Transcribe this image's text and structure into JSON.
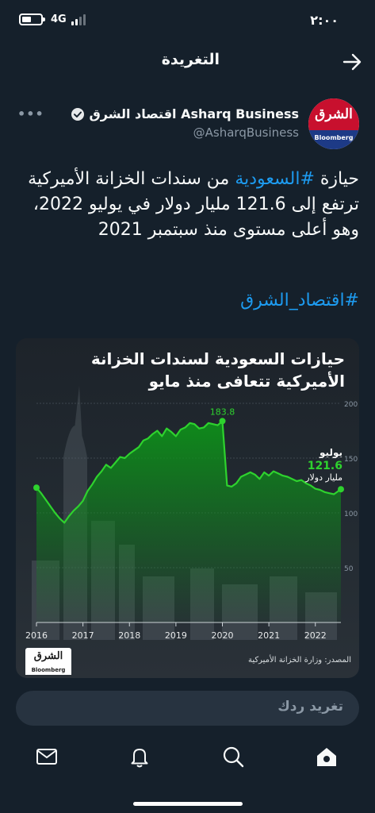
{
  "status_bar": {
    "time": "٢:٠٠",
    "network": "4G"
  },
  "header": {
    "title": "التغريدة"
  },
  "author": {
    "name": "اقتصاد الشرق Asharq Business",
    "handle": "@AsharqBusiness",
    "avatar_logo_top": "الشرق",
    "avatar_logo_bottom": "Bloomberg"
  },
  "tweet": {
    "text_before": "حيازة ",
    "hashtag_1": "#السعودية",
    "text_after": " من سندات الخزانة الأميركية ترتفع إلى 121.6 مليار دولار في يوليو 2022، وهو أعلى مستوى منذ سبتمبر 2021",
    "hashtag_2": "#اقتصاد_الشرق"
  },
  "media": {
    "title": "حيازات السعودية لسندات الخزانة الأميركية تتعافى منذ مايو",
    "source": "المصدر: وزارة الخزانة الأميركية",
    "logo_top": "الشرق",
    "logo_bottom": "Bloomberg"
  },
  "chart_data": {
    "type": "area",
    "title": "حيازات السعودية لسندات الخزانة الأميركية تتعافى منذ مايو",
    "x_ticks": [
      "2016",
      "2017",
      "2018",
      "2019",
      "2020",
      "2021",
      "2022"
    ],
    "y_ticks": [
      "200",
      "150",
      "100",
      "50"
    ],
    "ylabel": "",
    "ylim": [
      0,
      200
    ],
    "xlim": [
      2016,
      2022.55
    ],
    "grid": true,
    "x": [
      2016.0,
      2016.1,
      2016.2,
      2016.3,
      2016.4,
      2016.5,
      2016.6,
      2016.7,
      2016.8,
      2016.9,
      2017.0,
      2017.1,
      2017.2,
      2017.3,
      2017.4,
      2017.5,
      2017.6,
      2017.7,
      2017.8,
      2017.9,
      2018.0,
      2018.1,
      2018.2,
      2018.3,
      2018.4,
      2018.5,
      2018.6,
      2018.7,
      2018.8,
      2018.9,
      2019.0,
      2019.1,
      2019.2,
      2019.3,
      2019.4,
      2019.5,
      2019.6,
      2019.7,
      2019.8,
      2019.9,
      2020.0,
      2020.1,
      2020.2,
      2020.3,
      2020.4,
      2020.5,
      2020.6,
      2020.7,
      2020.8,
      2020.9,
      2021.0,
      2021.1,
      2021.2,
      2021.3,
      2021.4,
      2021.5,
      2021.6,
      2021.7,
      2021.8,
      2021.9,
      2022.0,
      2022.1,
      2022.2,
      2022.3,
      2022.4,
      2022.55
    ],
    "values": [
      123,
      118,
      112,
      106,
      100,
      95,
      91,
      97,
      102,
      106,
      111,
      120,
      126,
      133,
      138,
      144,
      141,
      146,
      151,
      150,
      154,
      157,
      160,
      166,
      168,
      172,
      175,
      170,
      177,
      174,
      170,
      176,
      178,
      182,
      181,
      177,
      178,
      182,
      181,
      180,
      183.8,
      125,
      124,
      127,
      133,
      135,
      137,
      135,
      131,
      137,
      134,
      138,
      136,
      134,
      133,
      131,
      129,
      130,
      127,
      125,
      122,
      121,
      119,
      118,
      117,
      121.6
    ],
    "peak_label": "183.8",
    "end_label": {
      "month": "يوليو",
      "value": "121.6",
      "unit": "مليار دولار"
    }
  },
  "reply": {
    "placeholder": "تغريد ردك"
  },
  "colors": {
    "background": "#15202b",
    "accent": "#1d9bf0",
    "chart_line": "#2ed22e",
    "chart_fill": "#0e8f1a"
  }
}
